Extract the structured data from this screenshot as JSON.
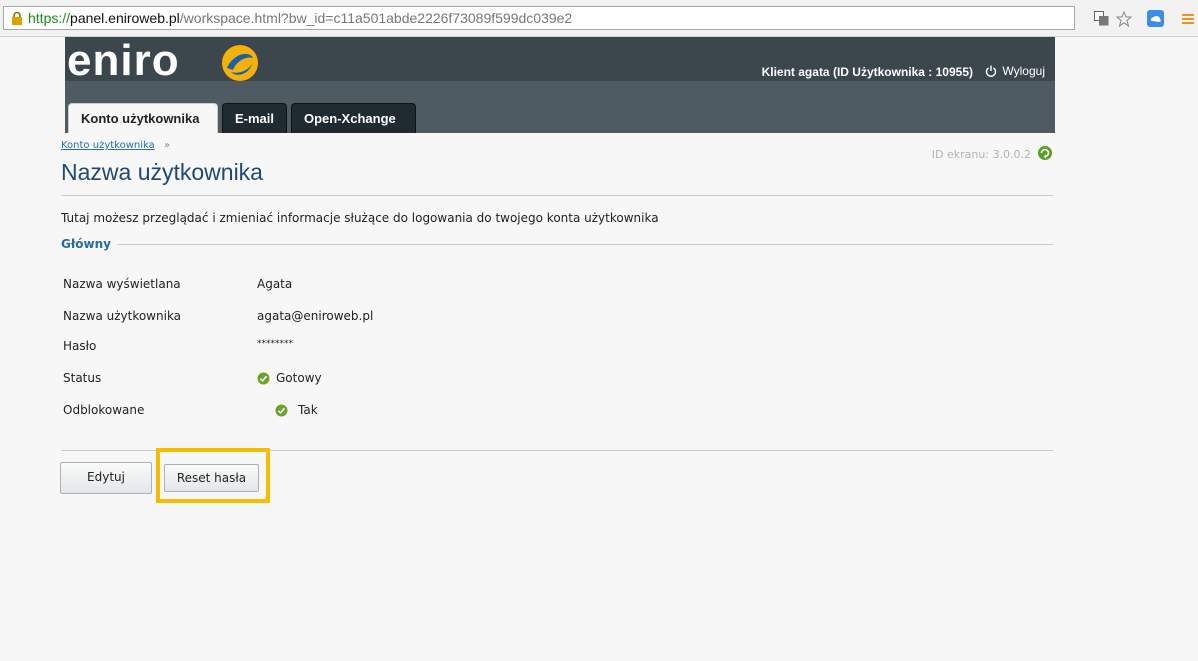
{
  "browser": {
    "url_scheme": "https://",
    "url_host": "panel.eniroweb.pl",
    "url_path": "/workspace.html?bw_id=c11a501abde2226f73089f599dc039e2"
  },
  "header": {
    "logo_text": "eniro",
    "client_info": "Klient agata (ID Użytkownika : 10955)",
    "logout_label": "Wyloguj"
  },
  "tabs": [
    {
      "label": "Konto użytkownika",
      "active": true
    },
    {
      "label": "E-mail",
      "active": false
    },
    {
      "label": "Open-Xchange",
      "active": false
    }
  ],
  "page": {
    "breadcrumb": "Konto użytkownika",
    "breadcrumb_sep": "»",
    "title": "Nazwa użytkownika",
    "screen_id": "ID ekranu: 3.0.0.2",
    "description": "Tutaj możesz przeglądać i zmieniać informacje służące do logowania do twojego konta użytkownika",
    "section_title": "Główny"
  },
  "fields": [
    {
      "label": "Nazwa wyświetlana",
      "value": "Agata"
    },
    {
      "label": "Nazwa użytkownika",
      "value": "agata@eniroweb.pl"
    },
    {
      "label": "Hasło",
      "value": "********"
    },
    {
      "label": "Status",
      "value": "Gotowy"
    },
    {
      "label": "Odblokowane",
      "value": "Tak"
    }
  ],
  "buttons": {
    "edit_label": "Edytuj",
    "reset_label": "Reset hasła"
  },
  "colors": {
    "header_bg": "#4f5b63",
    "title_blue": "#204a73",
    "highlight": "#f6bd00",
    "ok_green": "#6aa52a"
  },
  "icons": [
    "lock-icon",
    "translate-icon",
    "star-icon",
    "cloud-icon",
    "menu-icon",
    "power-icon",
    "refresh-icon",
    "check-circle-icon"
  ]
}
